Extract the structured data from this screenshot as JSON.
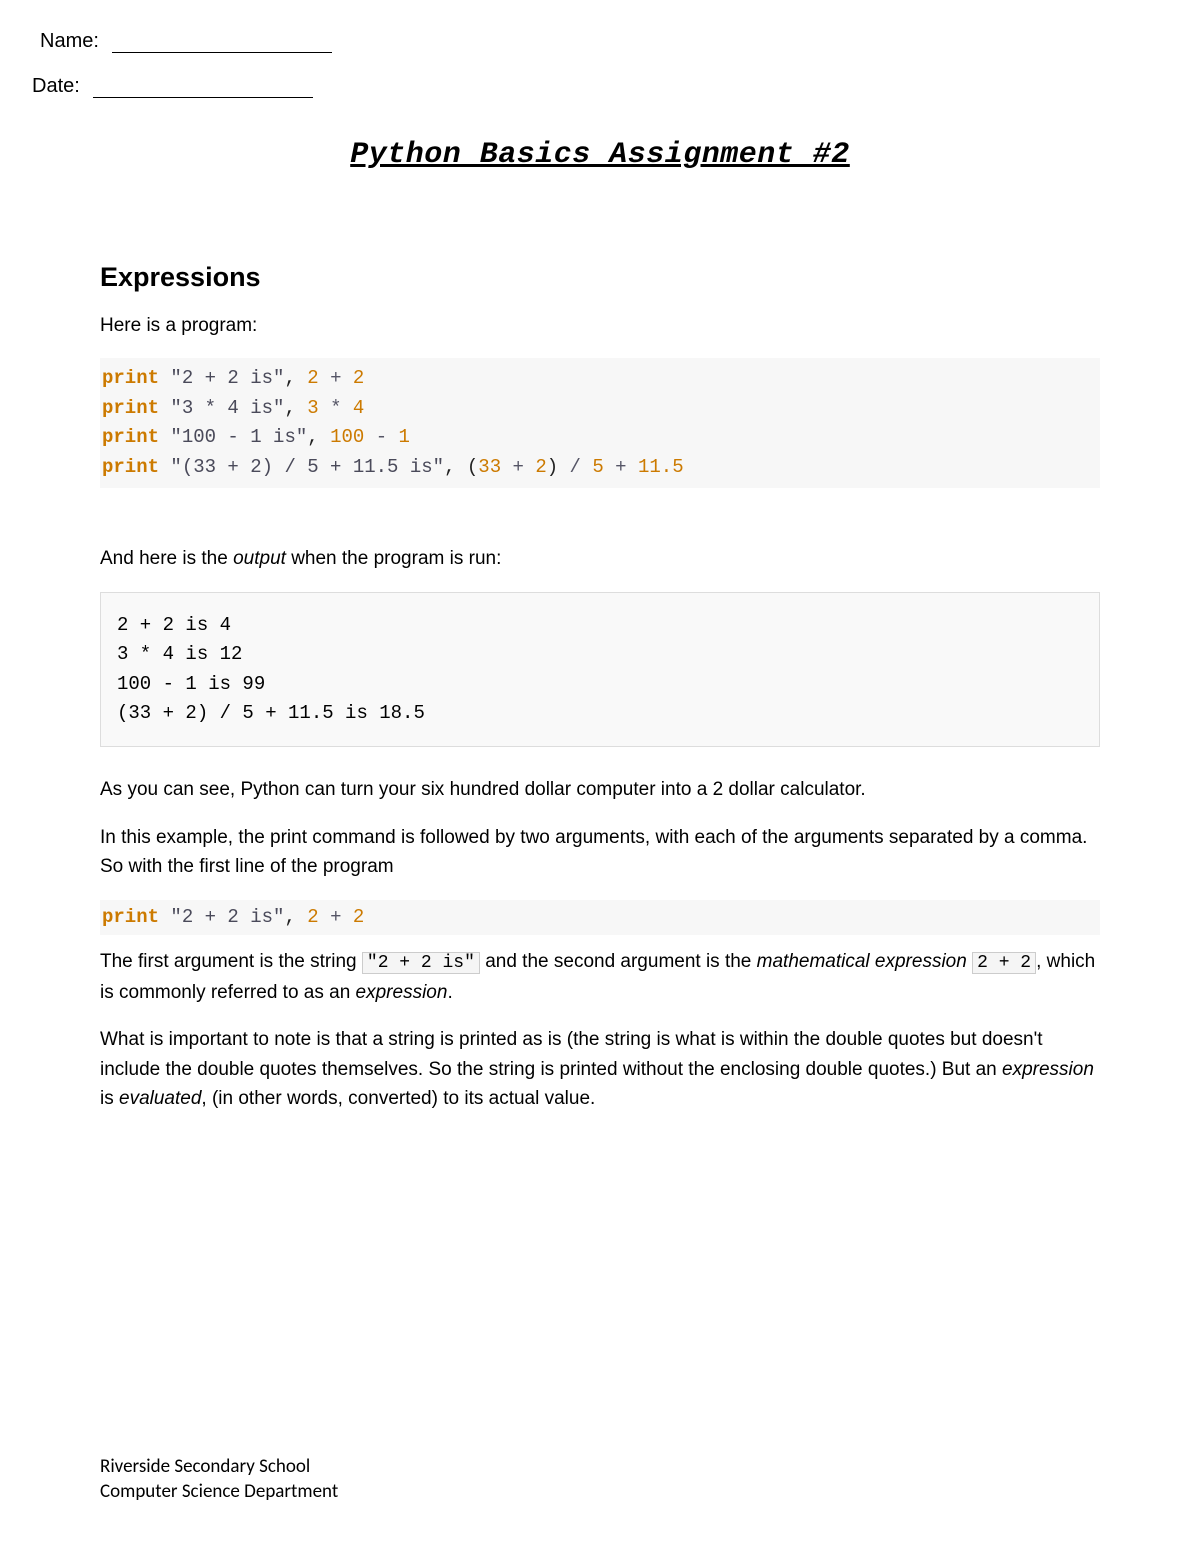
{
  "header": {
    "name_label": "Name:",
    "date_label": "Date:"
  },
  "title": "Python Basics Assignment #2",
  "section_heading": "Expressions",
  "intro": "Here is a program:",
  "code1": {
    "l1_kw": "print",
    "l1_str": "\"2 + 2 is\"",
    "l1_rest_a": "2",
    "l1_rest_b": "2",
    "l2_kw": "print",
    "l2_str": "\"3 * 4 is\"",
    "l2_rest_a": "3",
    "l2_rest_b": "4",
    "l3_kw": "print",
    "l3_str": "\"100 - 1 is\"",
    "l3_rest_a": "100",
    "l3_rest_b": "1",
    "l4_kw": "print",
    "l4_str": "\"(33 + 2) / 5 + 11.5 is\"",
    "l4_a": "33",
    "l4_b": "2",
    "l4_c": "5",
    "l4_d": "11.5"
  },
  "output_intro_pre": "And here is the ",
  "output_intro_em": "output",
  "output_intro_post": " when the program is run:",
  "output": "2 + 2 is 4\n3 * 4 is 12\n100 - 1 is 99\n(33 + 2) / 5 + 11.5 is 18.5",
  "p1": "As you can see, Python can turn your six hundred dollar computer into a 2 dollar calculator.",
  "p2": "In this example, the print command is followed by two arguments, with each of the arguments separated by a comma. So with the first line of the program",
  "code2": {
    "kw": "print",
    "str": "\"2 + 2 is\"",
    "a": "2",
    "b": "2"
  },
  "p3_a": "The first argument is the string ",
  "p3_code1": "\"2 + 2 is\"",
  "p3_b": " and the second argument is the ",
  "p3_em1": "mathematical expression",
  "p3_c": " ",
  "p3_code2": "2 + 2",
  "p3_d": ", which is commonly referred to as an ",
  "p3_em2": "expression",
  "p3_e": ".",
  "p4_a": "What is important to note is that a string is printed as is (the string is what is within the double quotes but doesn't include the double quotes themselves. So the string is printed without the enclosing double quotes.) But an ",
  "p4_em1": "expression",
  "p4_b": " is ",
  "p4_em2": "evaluated",
  "p4_c": ", (in other words, converted) to its actual value.",
  "footer": {
    "line1": "Riverside Secondary School",
    "line2": "Computer Science Department"
  }
}
